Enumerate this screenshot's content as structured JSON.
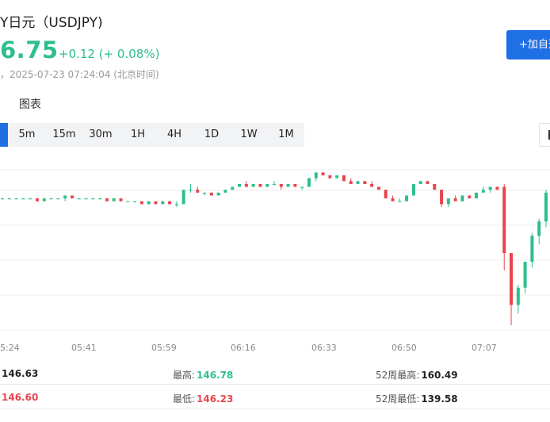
{
  "header": {
    "title": "Y日元（USDJPY)",
    "price": "6.75",
    "change": "+0.12 (+ 0.08%)",
    "timestamp": "，2025-07-23 07:24:04 (北京时间)",
    "watch_label": "+加自选"
  },
  "tabs": {
    "chart": "图表"
  },
  "intervals": [
    "",
    "5m",
    "15m",
    "30m",
    "1H",
    "4H",
    "1D",
    "1W",
    "1M"
  ],
  "active_interval": 0,
  "colors": {
    "up": "#2dbf8b",
    "down": "#e8454b",
    "accent": "#1f6fe5"
  },
  "chart_data": {
    "type": "candlestick",
    "xticks": [
      "5:24",
      "05:41",
      "05:59",
      "06:16",
      "06:33",
      "06:50",
      "07:07"
    ],
    "ylim": [
      146.18,
      146.83
    ],
    "grid": true,
    "candles": [
      [
        146.67,
        146.67,
        146.67,
        146.67
      ],
      [
        146.67,
        146.67,
        146.67,
        146.67
      ],
      [
        146.67,
        146.67,
        146.67,
        146.67
      ],
      [
        146.67,
        146.67,
        146.67,
        146.67
      ],
      [
        146.67,
        146.67,
        146.67,
        146.67
      ],
      [
        146.67,
        146.67,
        146.66,
        146.66
      ],
      [
        146.66,
        146.67,
        146.66,
        146.67
      ],
      [
        146.67,
        146.67,
        146.67,
        146.67
      ],
      [
        146.67,
        146.67,
        146.67,
        146.67
      ],
      [
        146.67,
        146.68,
        146.66,
        146.68
      ],
      [
        146.68,
        146.68,
        146.67,
        146.67
      ],
      [
        146.67,
        146.67,
        146.67,
        146.67
      ],
      [
        146.67,
        146.67,
        146.67,
        146.67
      ],
      [
        146.67,
        146.67,
        146.67,
        146.67
      ],
      [
        146.67,
        146.67,
        146.67,
        146.67
      ],
      [
        146.67,
        146.67,
        146.66,
        146.66
      ],
      [
        146.66,
        146.67,
        146.66,
        146.67
      ],
      [
        146.67,
        146.67,
        146.66,
        146.66
      ],
      [
        146.66,
        146.66,
        146.66,
        146.66
      ],
      [
        146.66,
        146.66,
        146.66,
        146.66
      ],
      [
        146.66,
        146.66,
        146.65,
        146.65
      ],
      [
        146.65,
        146.66,
        146.65,
        146.66
      ],
      [
        146.66,
        146.66,
        146.65,
        146.65
      ],
      [
        146.65,
        146.66,
        146.65,
        146.66
      ],
      [
        146.66,
        146.66,
        146.65,
        146.65
      ],
      [
        146.65,
        146.66,
        146.64,
        146.65
      ],
      [
        146.65,
        146.7,
        146.65,
        146.7
      ],
      [
        146.7,
        146.72,
        146.69,
        146.7
      ],
      [
        146.7,
        146.71,
        146.69,
        146.69
      ],
      [
        146.69,
        146.69,
        146.68,
        146.69
      ],
      [
        146.69,
        146.69,
        146.68,
        146.68
      ],
      [
        146.68,
        146.69,
        146.68,
        146.69
      ],
      [
        146.69,
        146.7,
        146.69,
        146.7
      ],
      [
        146.7,
        146.71,
        146.7,
        146.71
      ],
      [
        146.71,
        146.72,
        146.71,
        146.72
      ],
      [
        146.72,
        146.73,
        146.71,
        146.71
      ],
      [
        146.71,
        146.72,
        146.71,
        146.72
      ],
      [
        146.72,
        146.72,
        146.71,
        146.71
      ],
      [
        146.71,
        146.72,
        146.71,
        146.72
      ],
      [
        146.72,
        146.73,
        146.72,
        146.72
      ],
      [
        146.72,
        146.72,
        146.7,
        146.71
      ],
      [
        146.71,
        146.72,
        146.71,
        146.72
      ],
      [
        146.72,
        146.72,
        146.71,
        146.71
      ],
      [
        146.71,
        146.71,
        146.7,
        146.71
      ],
      [
        146.71,
        146.74,
        146.71,
        146.74
      ],
      [
        146.74,
        146.76,
        146.73,
        146.76
      ],
      [
        146.76,
        146.76,
        146.75,
        146.75
      ],
      [
        146.75,
        146.75,
        146.74,
        146.74
      ],
      [
        146.74,
        146.75,
        146.74,
        146.75
      ],
      [
        146.75,
        146.75,
        146.73,
        146.73
      ],
      [
        146.73,
        146.74,
        146.72,
        146.72
      ],
      [
        146.72,
        146.73,
        146.72,
        146.73
      ],
      [
        146.73,
        146.73,
        146.72,
        146.72
      ],
      [
        146.72,
        146.73,
        146.71,
        146.71
      ],
      [
        146.71,
        146.71,
        146.7,
        146.7
      ],
      [
        146.7,
        146.7,
        146.67,
        146.67
      ],
      [
        146.67,
        146.68,
        146.66,
        146.66
      ],
      [
        146.66,
        146.67,
        146.66,
        146.66
      ],
      [
        146.66,
        146.68,
        146.66,
        146.68
      ],
      [
        146.68,
        146.72,
        146.68,
        146.72
      ],
      [
        146.72,
        146.73,
        146.72,
        146.73
      ],
      [
        146.73,
        146.73,
        146.72,
        146.72
      ],
      [
        146.72,
        146.72,
        146.7,
        146.7
      ],
      [
        146.7,
        146.7,
        146.64,
        146.65
      ],
      [
        146.65,
        146.67,
        146.64,
        146.67
      ],
      [
        146.67,
        146.68,
        146.66,
        146.66
      ],
      [
        146.66,
        146.68,
        146.66,
        146.68
      ],
      [
        146.68,
        146.68,
        146.67,
        146.67
      ],
      [
        146.67,
        146.69,
        146.67,
        146.69
      ],
      [
        146.69,
        146.71,
        146.69,
        146.7
      ],
      [
        146.7,
        146.71,
        146.69,
        146.71
      ],
      [
        146.71,
        146.71,
        146.7,
        146.7
      ],
      [
        146.71,
        146.72,
        146.42,
        146.48
      ],
      [
        146.48,
        146.48,
        146.23,
        146.3
      ],
      [
        146.3,
        146.37,
        146.27,
        146.36
      ],
      [
        146.36,
        146.45,
        146.34,
        146.45
      ],
      [
        146.45,
        146.55,
        146.43,
        146.54
      ],
      [
        146.54,
        146.6,
        146.51,
        146.59
      ],
      [
        146.59,
        146.7,
        146.57,
        146.69
      ]
    ]
  },
  "stats": {
    "row1": [
      {
        "label": "",
        "value": "146.63",
        "color": "#222"
      },
      {
        "label": "最高:",
        "value": "146.78",
        "color": "#2dbf8b"
      },
      {
        "label": "52周最高:",
        "value": "160.49",
        "color": "#222"
      }
    ],
    "row2": [
      {
        "label": "",
        "value": "146.60",
        "color": "#e8454b"
      },
      {
        "label": "最低:",
        "value": "146.23",
        "color": "#e8454b"
      },
      {
        "label": "52周最低:",
        "value": "139.58",
        "color": "#222"
      }
    ]
  }
}
